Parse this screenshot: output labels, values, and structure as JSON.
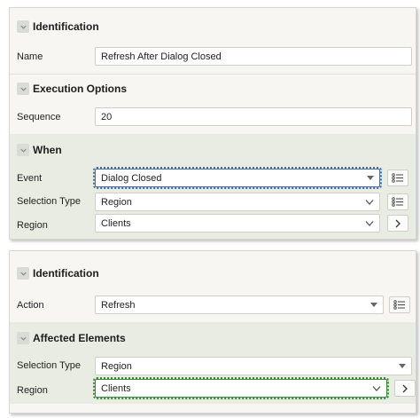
{
  "top_panel": {
    "identification": {
      "title": "Identification",
      "name_label": "Name",
      "name_value": "Refresh After Dialog Closed"
    },
    "execution_options": {
      "title": "Execution Options",
      "sequence_label": "Sequence",
      "sequence_value": "20"
    },
    "when": {
      "title": "When",
      "event_label": "Event",
      "event_value": "Dialog Closed",
      "selection_type_label": "Selection Type",
      "selection_type_value": "Region",
      "region_label": "Region",
      "region_value": "Clients"
    }
  },
  "bottom_panel": {
    "identification": {
      "title": "Identification",
      "action_label": "Action",
      "action_value": "Refresh"
    },
    "affected_elements": {
      "title": "Affected Elements",
      "selection_type_label": "Selection Type",
      "selection_type_value": "Region",
      "region_label": "Region",
      "region_value": "Clients"
    }
  },
  "icons": {
    "collapse": "chevron-down-icon",
    "list": "list-icon",
    "next": "chevron-right-icon",
    "caret": "caret-down-icon"
  },
  "colors": {
    "panel_bg": "#f7f6f3",
    "section_green": "#e9ece3",
    "focus_blue": "#4a6fa5",
    "focus_green": "#3a8a3a"
  }
}
